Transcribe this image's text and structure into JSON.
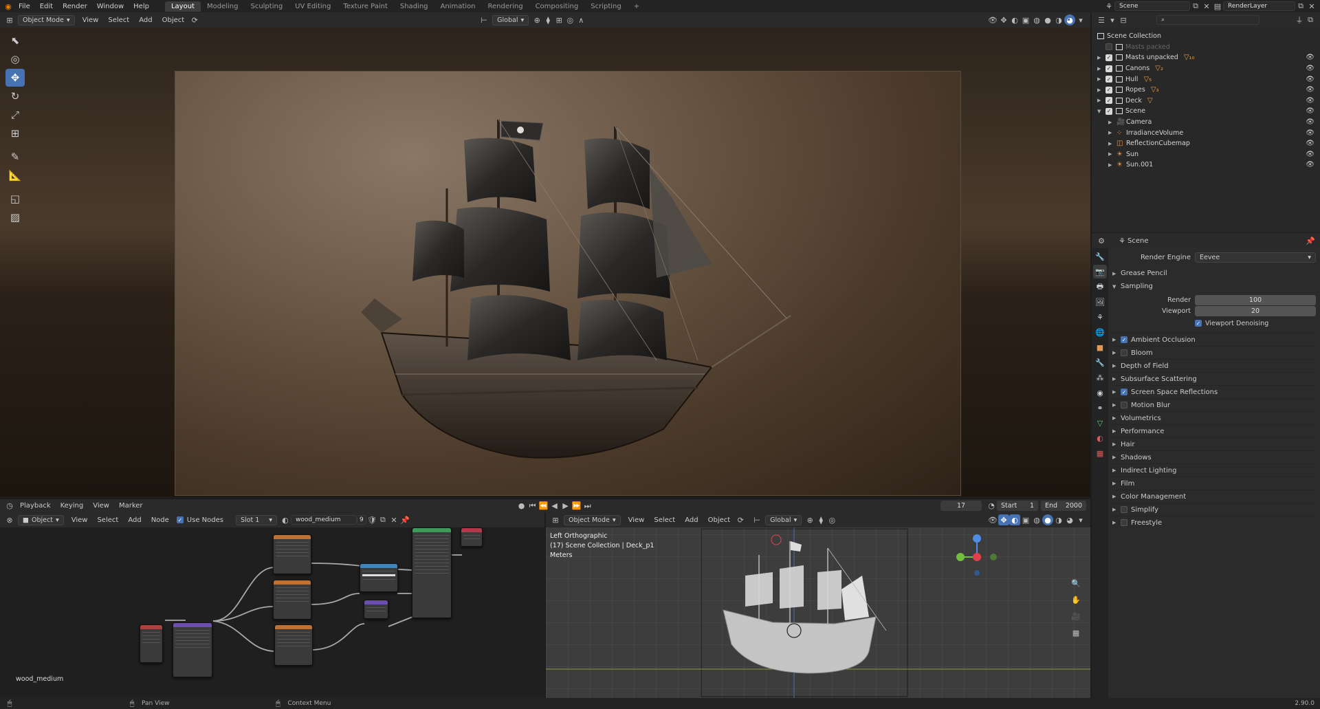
{
  "topbar": {
    "menus": [
      "File",
      "Edit",
      "Render",
      "Window",
      "Help"
    ],
    "workspaces": [
      "Layout",
      "Modeling",
      "Sculpting",
      "UV Editing",
      "Texture Paint",
      "Shading",
      "Animation",
      "Rendering",
      "Compositing",
      "Scripting"
    ],
    "active_workspace": "Layout",
    "add_tab": "+",
    "scene_name": "Scene",
    "render_layer": "RenderLayer"
  },
  "viewport": {
    "mode": "Object Mode",
    "menus": [
      "View",
      "Select",
      "Add",
      "Object"
    ],
    "orientation": "Global"
  },
  "outliner": {
    "root": "Scene Collection",
    "items": [
      {
        "label": "Masts packed",
        "indent": 1,
        "checked": false,
        "disabled": true,
        "badge": ""
      },
      {
        "label": "Masts unpacked",
        "indent": 1,
        "checked": true,
        "badge": "▽₁₀"
      },
      {
        "label": "Canons",
        "indent": 1,
        "checked": true,
        "badge": "▽₂"
      },
      {
        "label": "Hull",
        "indent": 1,
        "checked": true,
        "badge": "▽₅"
      },
      {
        "label": "Ropes",
        "indent": 1,
        "checked": true,
        "badge": "▽₃"
      },
      {
        "label": "Deck",
        "indent": 1,
        "checked": true,
        "badge": "▽"
      },
      {
        "label": "Scene",
        "indent": 1,
        "checked": true,
        "badge": "",
        "open": true
      },
      {
        "label": "Camera",
        "indent": 2,
        "checked": null,
        "badge": ""
      },
      {
        "label": "IrradianceVolume",
        "indent": 2,
        "checked": null,
        "badge": ""
      },
      {
        "label": "ReflectionCubemap",
        "indent": 2,
        "checked": null,
        "badge": ""
      },
      {
        "label": "Sun",
        "indent": 2,
        "checked": null,
        "badge": ""
      },
      {
        "label": "Sun.001",
        "indent": 2,
        "checked": null,
        "badge": ""
      }
    ]
  },
  "properties": {
    "context": "Scene",
    "render_engine_label": "Render Engine",
    "render_engine": "Eevee",
    "grease_pencil": "Grease Pencil",
    "sampling": "Sampling",
    "render_label": "Render",
    "render_value": "100",
    "viewport_label": "Viewport",
    "viewport_value": "20",
    "viewport_denoising": "Viewport Denoising",
    "panels": [
      {
        "label": "Ambient Occlusion",
        "check": true
      },
      {
        "label": "Bloom",
        "check": false
      },
      {
        "label": "Depth of Field",
        "check": null
      },
      {
        "label": "Subsurface Scattering",
        "check": null
      },
      {
        "label": "Screen Space Reflections",
        "check": true
      },
      {
        "label": "Motion Blur",
        "check": false
      },
      {
        "label": "Volumetrics",
        "check": null
      },
      {
        "label": "Performance",
        "check": null
      },
      {
        "label": "Hair",
        "check": null
      },
      {
        "label": "Shadows",
        "check": null
      },
      {
        "label": "Indirect Lighting",
        "check": null
      },
      {
        "label": "Film",
        "check": null
      },
      {
        "label": "Color Management",
        "check": null
      },
      {
        "label": "Simplify",
        "check": false
      },
      {
        "label": "Freestyle",
        "check": false
      }
    ]
  },
  "timeline": {
    "menus": [
      "Playback",
      "Keying",
      "View",
      "Marker"
    ],
    "current_frame": "17",
    "start_label": "Start",
    "start": "1",
    "end_label": "End",
    "end": "2000"
  },
  "node_editor": {
    "type": "Object",
    "menus": [
      "View",
      "Select",
      "Add",
      "Node"
    ],
    "use_nodes": "Use Nodes",
    "slot": "Slot 1",
    "material": "wood_medium",
    "users": "9",
    "material_label": "wood_medium"
  },
  "ortho": {
    "mode": "Object Mode",
    "menus": [
      "View",
      "Select",
      "Add",
      "Object"
    ],
    "orientation": "Global",
    "view_name": "Left Orthographic",
    "collection_info": "(17) Scene Collection | Deck_p1",
    "units": "Meters"
  },
  "status": {
    "pan": "Pan View",
    "context": "Context Menu",
    "version": "2.90.0"
  },
  "colors": {
    "accent": "#4772b3",
    "header": "#2a2a2a",
    "panel": "#2b2b2b"
  }
}
